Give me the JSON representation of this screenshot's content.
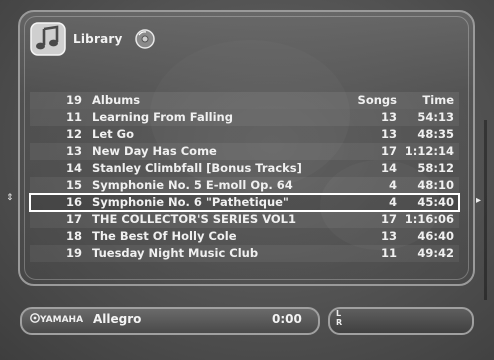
{
  "header": {
    "title": "Library"
  },
  "table": {
    "columns": {
      "count": "19",
      "name": "Albums",
      "songs": "Songs",
      "time": "Time"
    },
    "rows": [
      {
        "num": "11",
        "title": "Learning From Falling",
        "songs": "13",
        "time": "54:13"
      },
      {
        "num": "12",
        "title": "Let Go",
        "songs": "13",
        "time": "48:35"
      },
      {
        "num": "13",
        "title": "New Day Has Come",
        "songs": "17",
        "time": "1:12:14"
      },
      {
        "num": "14",
        "title": "Stanley Climbfall [Bonus Tracks]",
        "songs": "14",
        "time": "58:12"
      },
      {
        "num": "15",
        "title": "Symphonie No. 5 E-moll Op. 64",
        "songs": "4",
        "time": "48:10"
      },
      {
        "num": "16",
        "title": "Symphonie No. 6 \"Pathetique\"",
        "songs": "4",
        "time": "45:40"
      },
      {
        "num": "17",
        "title": "THE COLLECTOR'S SERIES VOL1",
        "songs": "17",
        "time": "1:16:06"
      },
      {
        "num": "18",
        "title": "The Best Of Holly Cole",
        "songs": "13",
        "time": "46:40"
      },
      {
        "num": "19",
        "title": "Tuesday Night Music Club",
        "songs": "11",
        "time": "49:42"
      }
    ],
    "selected_index": 5
  },
  "nav": {
    "up_down_arrows": "⇕",
    "right_arrow": "▸"
  },
  "player": {
    "brand": "YAMAHA",
    "now_playing": "Allegro",
    "position": "0:00",
    "meter_label_l": "L",
    "meter_label_r": "R"
  },
  "icons": {
    "library": "music-note-icon",
    "disc": "disc-icon",
    "brand": "yamaha-logo-icon"
  },
  "colors": {
    "text": "#f0f0f0",
    "selection": "#ffffff",
    "panel_border": "#9a9a9a"
  }
}
